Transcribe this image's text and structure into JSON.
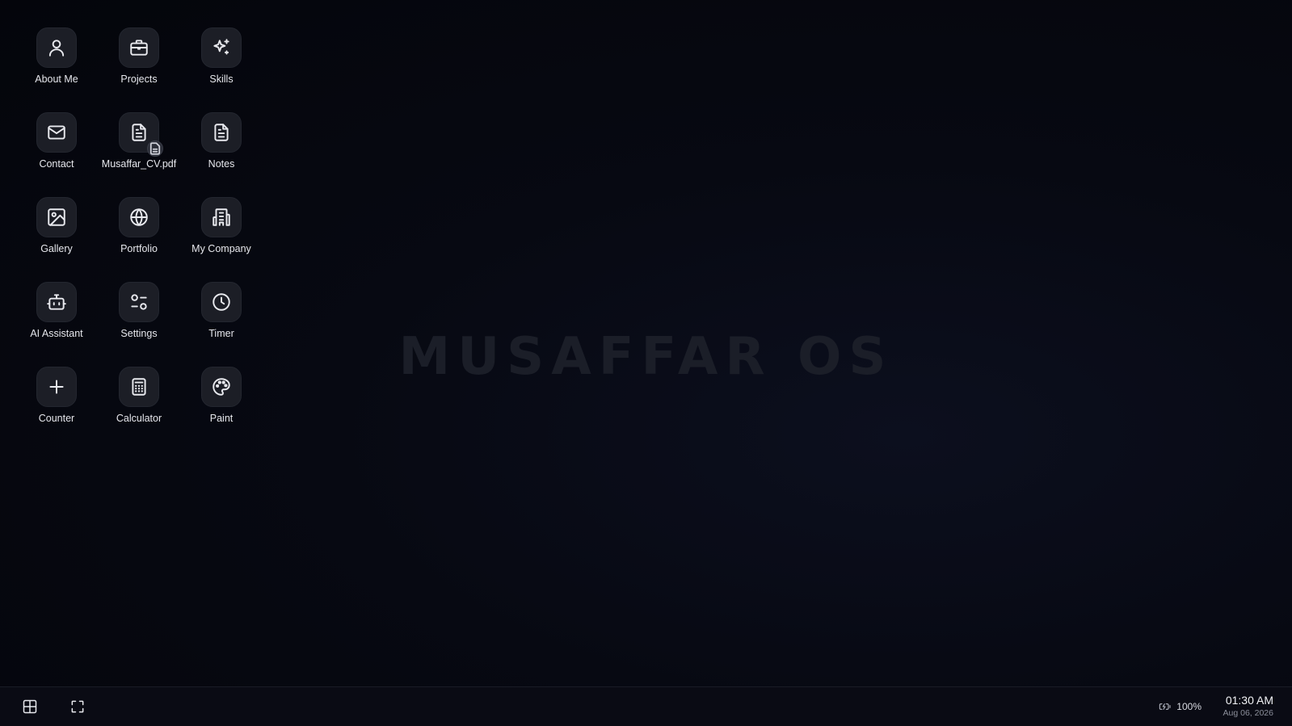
{
  "desktop": {
    "watermark": "MUSAFFAR OS",
    "icons": [
      {
        "label": "About Me",
        "icon": "user-icon"
      },
      {
        "label": "Projects",
        "icon": "briefcase-icon"
      },
      {
        "label": "Skills",
        "icon": "sparkles-icon"
      },
      {
        "label": "Contact",
        "icon": "mail-icon"
      },
      {
        "label": "Musaffar_CV.pdf",
        "icon": "file-text-icon"
      },
      {
        "label": "Notes",
        "icon": "file-text-icon"
      },
      {
        "label": "Gallery",
        "icon": "image-icon"
      },
      {
        "label": "Portfolio",
        "icon": "globe-icon"
      },
      {
        "label": "My Company",
        "icon": "building-icon"
      },
      {
        "label": "AI Assistant",
        "icon": "bot-icon"
      },
      {
        "label": "Settings",
        "icon": "sliders-icon"
      },
      {
        "label": "Timer",
        "icon": "clock-icon"
      },
      {
        "label": "Counter",
        "icon": "plus-icon"
      },
      {
        "label": "Calculator",
        "icon": "calculator-icon"
      },
      {
        "label": "Paint",
        "icon": "palette-icon"
      }
    ]
  },
  "taskbar": {
    "start_icon": "grid-icon",
    "fullscreen_icon": "fullscreen-icon",
    "battery_icon": "battery-charging-icon",
    "battery_percent": "100%",
    "time": "01:30 AM",
    "date": "Aug 06, 2026"
  },
  "colors": {
    "background": "#05060d",
    "tile": "#1c1e26",
    "watermark": "#1b1e28",
    "taskbar": "#0a0b14"
  }
}
